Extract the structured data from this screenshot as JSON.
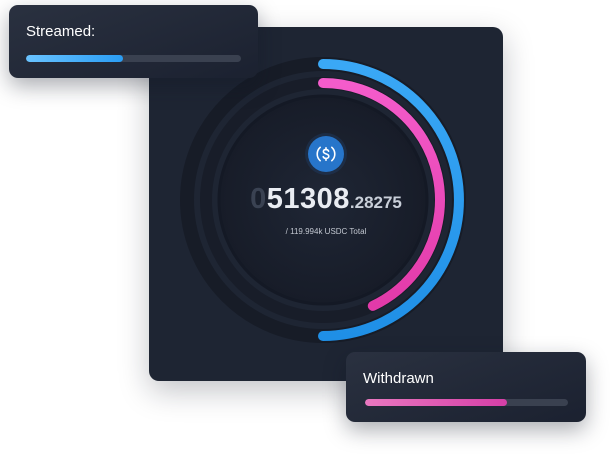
{
  "stream_card": {
    "amount_leading": "0",
    "amount_integer": "51308",
    "amount_decimal": ".28275",
    "total_text": "/ 119.994k USDC Total",
    "token_icon": "usdc-dollar-icon",
    "colors": {
      "card_bg": "#1e2533",
      "streamed": "#2a9df4",
      "withdrawn": "#f048c0",
      "token": "#2775ca"
    },
    "streamed_ring_fraction": 0.5,
    "withdrawn_ring_fraction": 0.43
  },
  "streamed_panel": {
    "label": "Streamed:",
    "progress_fraction": 0.45
  },
  "withdrawn_panel": {
    "label": "Withdrawn",
    "progress_fraction": 0.7
  }
}
